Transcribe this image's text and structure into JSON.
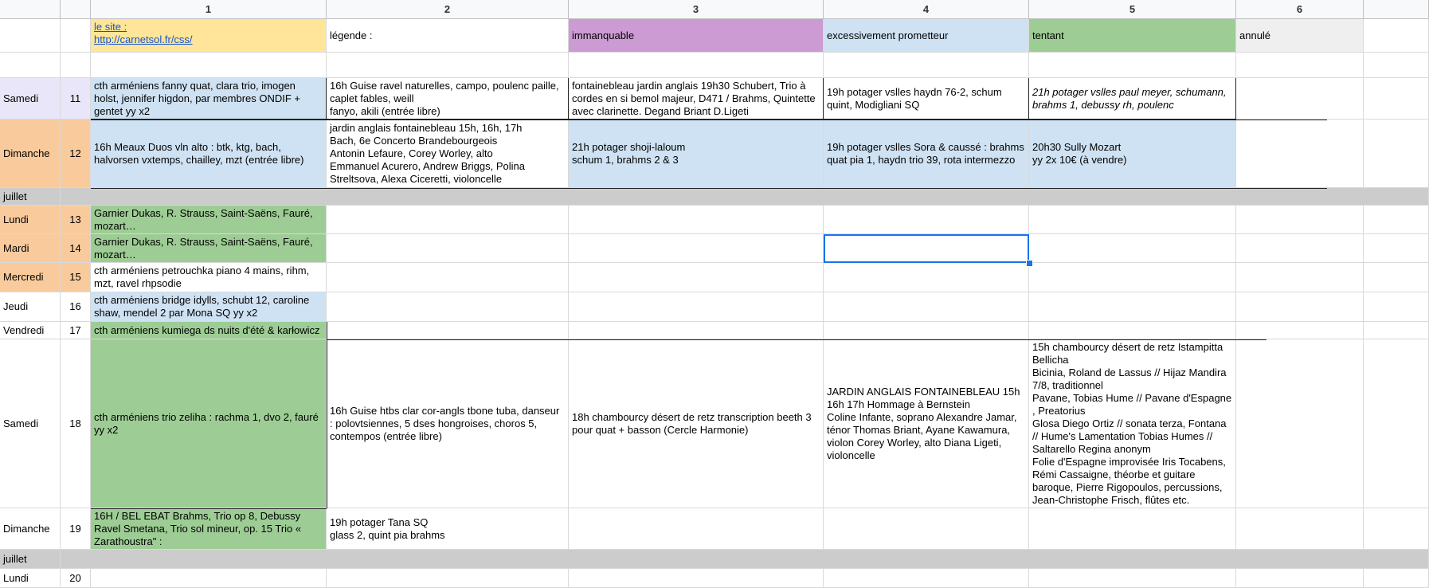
{
  "column_headers": [
    "1",
    "2",
    "3",
    "4",
    "5",
    "6"
  ],
  "legend": {
    "site_label": "le site :",
    "site_url": "http://carnetsol.fr/css/",
    "legende": "légende :",
    "immanquable": "immanquable",
    "prometteur": "excessivement prometteur",
    "tentant": "tentant",
    "annule": "annulé"
  },
  "colors": {
    "header_bg": "#f8f9fa",
    "immanquable": "#cd9bd3",
    "prometteur": "#cfe2f3",
    "tentant": "#9dcd94",
    "annule": "#efefef",
    "site": "#ffe599",
    "weekend": "#e8e6f8",
    "weekday": "#f9cb9c",
    "month_row": "#cccccc",
    "selection": "#1a73e8"
  },
  "rows": [
    {
      "day": "Samedi",
      "num": "11",
      "c1": "cth arméniens fanny quat, clara trio, imogen holst, jennifer higdon, par membres ONDIF + gentet yy x2",
      "c2": "16h Guise ravel naturelles, campo, poulenc paille, caplet fables, weill\nfanyo, akili (entrée libre)",
      "c3": "fontainebleau jardin anglais 19h30 Schubert, Trio à cordes en si bemol majeur, D471 / Brahms, Quintette avec clarinette. Degand Briant D.Ligeti",
      "c4": "19h potager vslles haydn 76-2, schum quint, Modigliani SQ",
      "c5": "21h potager vslles paul meyer, schumann, brahms 1, debussy rh, poulenc",
      "c6": ""
    },
    {
      "day": "Dimanche",
      "num": "12",
      "c1": "16h Meaux Duos vln alto : btk, ktg, bach, halvorsen vxtemps, chailley, mzt (entrée libre)",
      "c2": "jardin anglais fontainebleau 15h, 16h, 17h\nBach, 6e Concerto Brandebourgeois\nAntonin Lefaure, Corey Worley, alto\nEmmanuel Acurero, Andrew Briggs, Polina Streltsova, Alexa Ciceretti, violoncelle",
      "c3": "21h potager shoji-laloum\nschum 1, brahms 2 & 3",
      "c4": "19h potager vslles Sora & caussé : brahms quat pia 1, haydn trio 39, rota intermezzo",
      "c5": "20h30 Sully Mozart\nyy 2x 10€ (à vendre)",
      "c6": ""
    },
    {
      "day": "juillet",
      "num": "",
      "c1": "",
      "c2": "",
      "c3": "",
      "c4": "",
      "c5": "",
      "c6": ""
    },
    {
      "day": "Lundi",
      "num": "13",
      "c1": "Garnier Dukas, R. Strauss, Saint-Saëns, Fauré, mozart…",
      "c2": "",
      "c3": "",
      "c4": "",
      "c5": "",
      "c6": ""
    },
    {
      "day": "Mardi",
      "num": "14",
      "c1": "Garnier Dukas, R. Strauss, Saint-Saëns, Fauré, mozart…",
      "c2": "",
      "c3": "",
      "c4": "",
      "c5": "",
      "c6": ""
    },
    {
      "day": "Mercredi",
      "num": "15",
      "c1": "cth arméniens petrouchka piano 4 mains, rihm, mzt, ravel rhpsodie",
      "c2": "",
      "c3": "",
      "c4": "",
      "c5": "",
      "c6": ""
    },
    {
      "day": "Jeudi",
      "num": "16",
      "c1": "cth arméniens bridge idylls, schubt 12, caroline shaw, mendel 2 par Mona SQ yy x2",
      "c2": "",
      "c3": "",
      "c4": "",
      "c5": "",
      "c6": ""
    },
    {
      "day": "Vendredi",
      "num": "17",
      "c1": "cth arméniens kumiega ds nuits d'été & karłowicz",
      "c2": "",
      "c3": "",
      "c4": "",
      "c5": "",
      "c6": ""
    },
    {
      "day": "Samedi",
      "num": "18",
      "c1": "cth arméniens trio zeliha : rachma 1, dvo 2, fauré yy x2",
      "c2": "16h Guise htbs clar cor-angls tbone tuba, danseur : polovtsiennes, 5 dses hongroises, choros 5, contempos (entrée libre)",
      "c3": "18h chambourcy désert de retz transcription beeth 3 pour quat + basson (Cercle Harmonie)",
      "c4": "JARDIN ANGLAIS FONTAINEBLEAU 15h 16h 17h Hommage à Bernstein\nColine Infante, soprano Alexandre Jamar, ténor Thomas Briant, Ayane Kawamura, violon Corey Worley, alto Diana Ligeti, violoncelle",
      "c5": "15h chambourcy désert de retz Istampitta Bellicha\nBicinia, Roland de Lassus // Hijaz Mandira 7/8, traditionnel\nPavane, Tobias Hume // Pavane d'Espagne , Preatorius\nGlosa Diego Ortiz // sonata terza, Fontana // Hume's Lamentation Tobias Humes // Saltarello Regina anonym\nFolie d'Espagne improvisée Iris Tocabens, Rémi Cassaigne, théorbe et guitare baroque, Pierre Rigopoulos, percussions, Jean-Christophe Frisch, flûtes etc.",
      "c6": ""
    },
    {
      "day": "Dimanche",
      "num": "19",
      "c1": "16H / BEL EBAT Brahms, Trio op 8, Debussy Ravel Smetana, Trio sol mineur, op. 15 Trio « Zarathoustra\" :",
      "c2": "19h potager Tana SQ\nglass 2, quint pia brahms",
      "c3": "",
      "c4": "",
      "c5": "",
      "c6": ""
    },
    {
      "day": "juillet",
      "num": "",
      "c1": "",
      "c2": "",
      "c3": "",
      "c4": "",
      "c5": "",
      "c6": ""
    },
    {
      "day": "Lundi",
      "num": "20",
      "c1": "",
      "c2": "",
      "c3": "",
      "c4": "",
      "c5": "",
      "c6": ""
    }
  ]
}
